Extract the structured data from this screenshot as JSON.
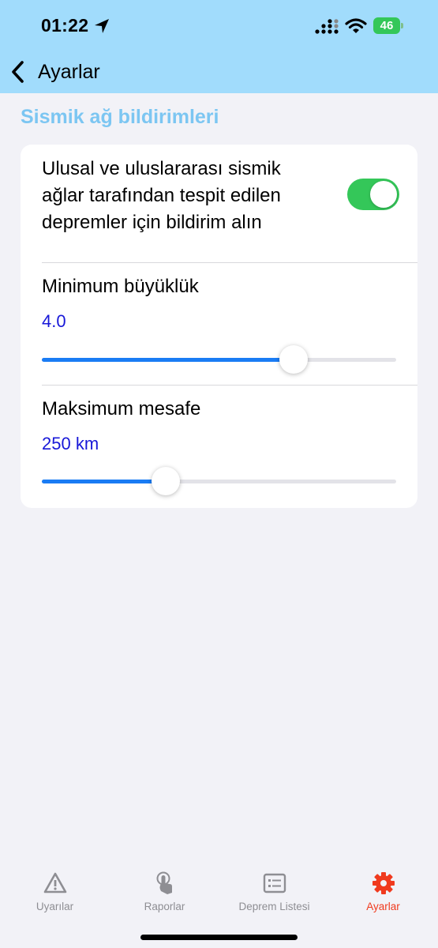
{
  "status_bar": {
    "time": "01:22",
    "battery": "46",
    "icons": [
      "location-arrow-icon",
      "signal-icon",
      "wifi-icon",
      "battery-icon"
    ]
  },
  "nav": {
    "back_label": "Ayarlar",
    "back_icon": "chevron-left-icon"
  },
  "section": {
    "title": "Sismik ağ bildirimleri"
  },
  "notification": {
    "text": "Ulusal ve uluslararası sismik ağlar tarafından tespit edilen depremler için bildirim alın",
    "enabled": true
  },
  "sliders": {
    "min_magnitude": {
      "title": "Minimum büyüklük",
      "value": "4.0",
      "fill_fraction": 0.71
    },
    "max_distance": {
      "title": "Maksimum mesafe",
      "value": "250 km",
      "fill_fraction": 0.35
    }
  },
  "tabs": [
    {
      "label": "Uyarılar",
      "icon": "warning-triangle-icon",
      "active": false
    },
    {
      "label": "Raporlar",
      "icon": "hand-tap-icon",
      "active": false
    },
    {
      "label": "Deprem Listesi",
      "icon": "list-icon",
      "active": false
    },
    {
      "label": "Ayarlar",
      "icon": "gear-icon",
      "active": true
    }
  ],
  "colors": {
    "header_bg": "#a1dcfc",
    "page_bg": "#f2f2f7",
    "section_title": "#7cc6f2",
    "toggle_on": "#34c759",
    "slider_fill": "#1a7cf4",
    "slider_value": "#1818d8",
    "tab_active": "#f03a1e",
    "tab_inactive": "#8e8e93"
  }
}
